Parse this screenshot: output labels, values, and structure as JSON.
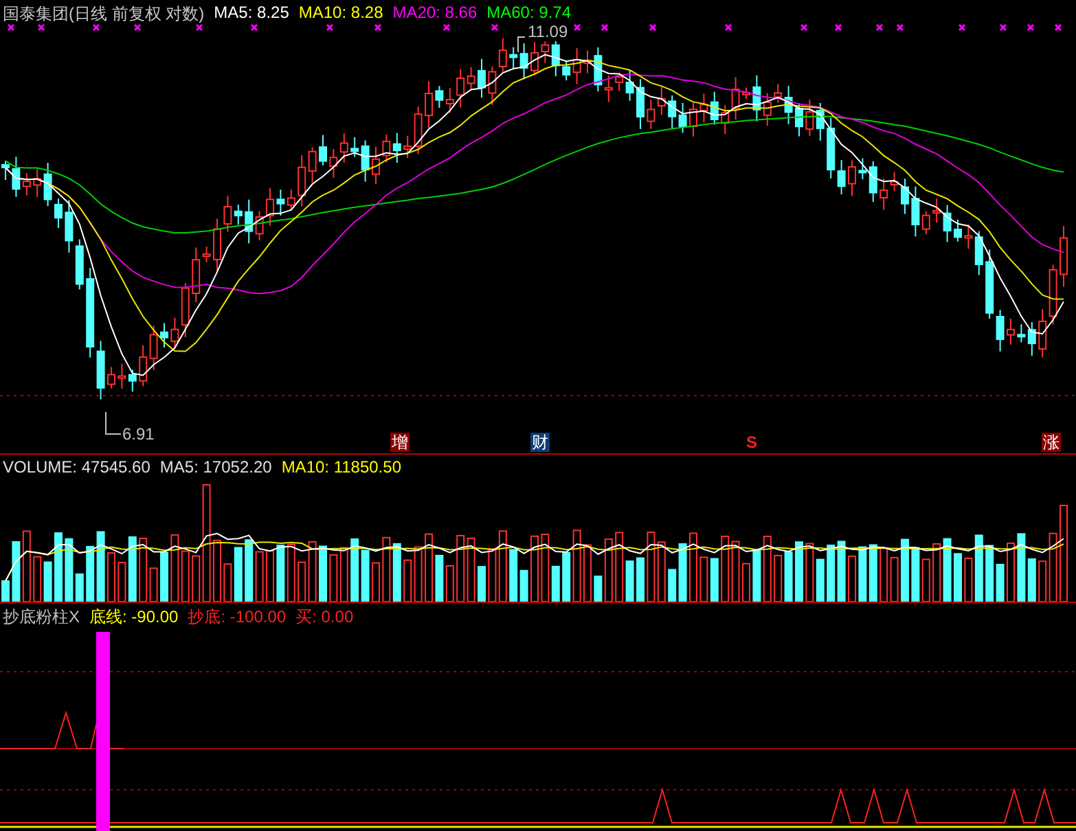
{
  "price_panel": {
    "title": "国泰集团(日线 前复权 对数)",
    "indicators": [
      {
        "label": "MA5: 8.25",
        "color": "#ffffff"
      },
      {
        "label": "MA10: 8.28",
        "color": "#ffff00"
      },
      {
        "label": "MA20: 8.66",
        "color": "#ff00ff"
      },
      {
        "label": "MA60: 9.74",
        "color": "#00ff00"
      }
    ],
    "high_label": "11.09",
    "low_label": "6.91",
    "event_markers": [
      {
        "text": "增",
        "kind": "box",
        "color": "#8b0000"
      },
      {
        "text": "财",
        "kind": "box",
        "color": "#0a3d7a"
      },
      {
        "text": "S",
        "kind": "arrow",
        "color": "#ff2020"
      },
      {
        "text": "涨",
        "kind": "box",
        "color": "#8b0000"
      }
    ]
  },
  "volume_panel": {
    "indicators": [
      {
        "label": "VOLUME: 47545.60",
        "color": "#e0e0e0"
      },
      {
        "label": "MA5: 17052.20",
        "color": "#e0e0e0"
      },
      {
        "label": "MA10: 11850.50",
        "color": "#ffff00"
      }
    ]
  },
  "signal_panel": {
    "indicators": [
      {
        "label": "抄底粉柱X",
        "color": "#c0c0c0"
      },
      {
        "label": "底线: -90.00",
        "color": "#ffff00"
      },
      {
        "label": "抄底: -100.00",
        "color": "#ff2020"
      },
      {
        "label": "买: 0.00",
        "color": "#ff2020"
      }
    ]
  }
}
